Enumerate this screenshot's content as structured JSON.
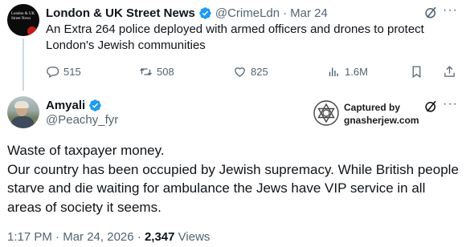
{
  "parent_tweet": {
    "avatar_logo_text": "London & UK Street News",
    "author_name": "London & UK Street News",
    "handle": "@CrimeLdn",
    "separator": "·",
    "date": "Mar 24",
    "text": "An Extra 264 police deployed with armed officers and drones to protect London's Jewish communities",
    "replies": "515",
    "reposts": "508",
    "likes": "825",
    "views": "1.6M"
  },
  "tweet": {
    "author_name": "Amyali",
    "handle": "@Peachy_fyr",
    "text_lines": [
      "Waste of taxpayer money.",
      "Our country has been occupied by Jewish supremacy. While British people starve and die waiting for ambulance the Jews have VIP service in all areas of society it seems."
    ],
    "time": "1:17 PM",
    "separator": "·",
    "date": "Mar 24, 2026",
    "separator2": "·",
    "views_count": "2,347",
    "views_label": "Views"
  },
  "watermark": {
    "line1": "Captured by",
    "line2": "gnasherjew.com"
  },
  "colors": {
    "verified_blue": "#1d9bf0",
    "muted_text": "#536471",
    "primary_text": "#0f1419",
    "thread_line": "#cfd9de"
  },
  "icons": [
    "reply-icon",
    "repost-icon",
    "like-icon",
    "views-icon",
    "bookmark-icon",
    "share-icon",
    "grok-icon",
    "more-icon",
    "verified-badge-icon"
  ]
}
